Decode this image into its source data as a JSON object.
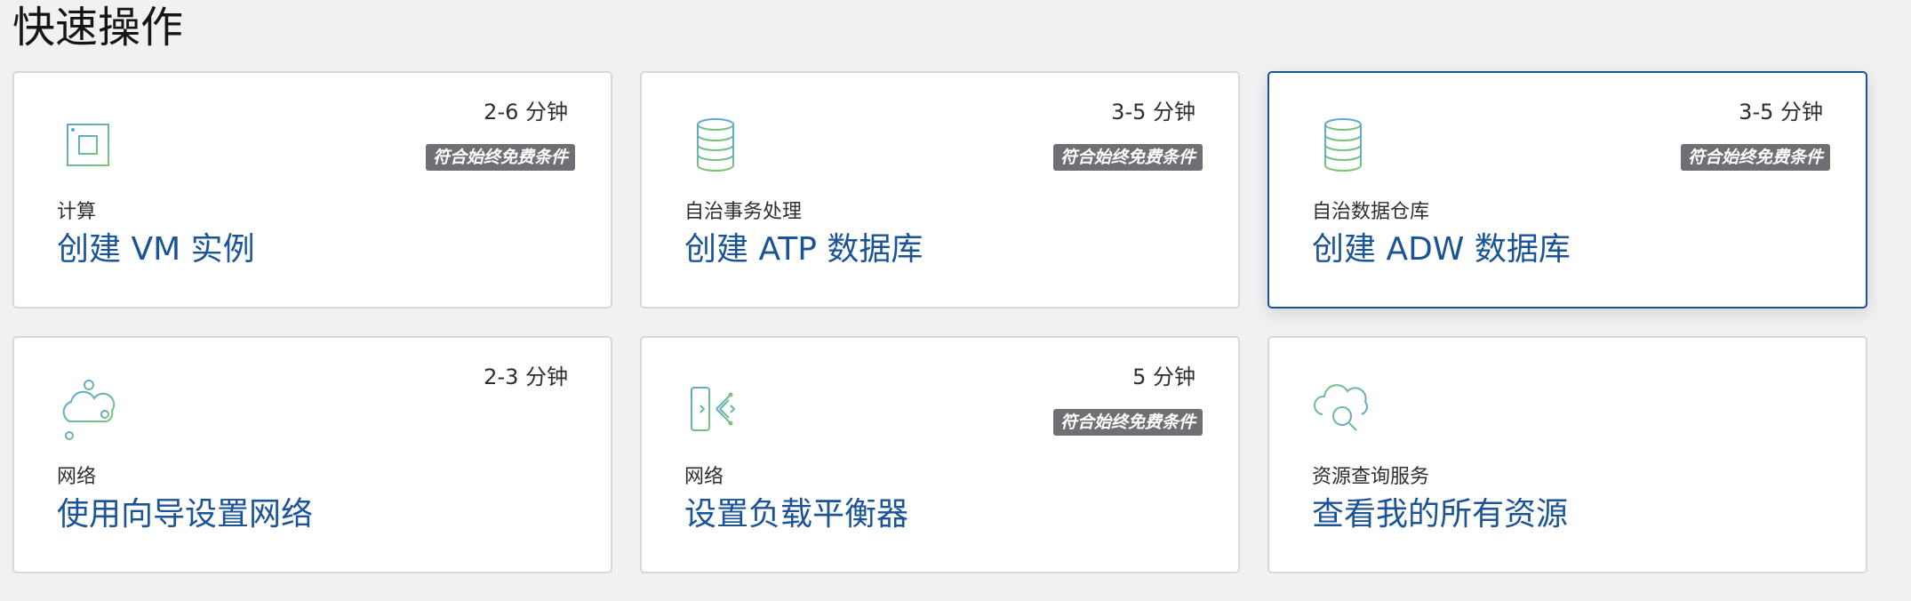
{
  "section": {
    "title": "快速操作"
  },
  "colors": {
    "link": "#1b5397",
    "badge_bg": "#6f7074",
    "icon_green": "#7cc576",
    "icon_blue": "#5aa6d8"
  },
  "cards": [
    {
      "icon": "cpu-chip-icon",
      "time": "2-6 分钟",
      "badge": "符合始终免费条件",
      "category": "计算",
      "action": "创建 VM 实例"
    },
    {
      "icon": "database-icon",
      "time": "3-5 分钟",
      "badge": "符合始终免费条件",
      "category": "自治事务处理",
      "action": "创建 ATP 数据库"
    },
    {
      "icon": "database-icon",
      "time": "3-5 分钟",
      "badge": "符合始终免费条件",
      "category": "自治数据仓库",
      "action": "创建 ADW 数据库"
    },
    {
      "icon": "network-cloud-icon",
      "time": "2-3 分钟",
      "badge": "",
      "category": "网络",
      "action": "使用向导设置网络"
    },
    {
      "icon": "load-balancer-icon",
      "time": "5 分钟",
      "badge": "符合始终免费条件",
      "category": "网络",
      "action": "设置负载平衡器"
    },
    {
      "icon": "cloud-search-icon",
      "time": "",
      "badge": "",
      "category": "资源查询服务",
      "action": "查看我的所有资源"
    }
  ]
}
